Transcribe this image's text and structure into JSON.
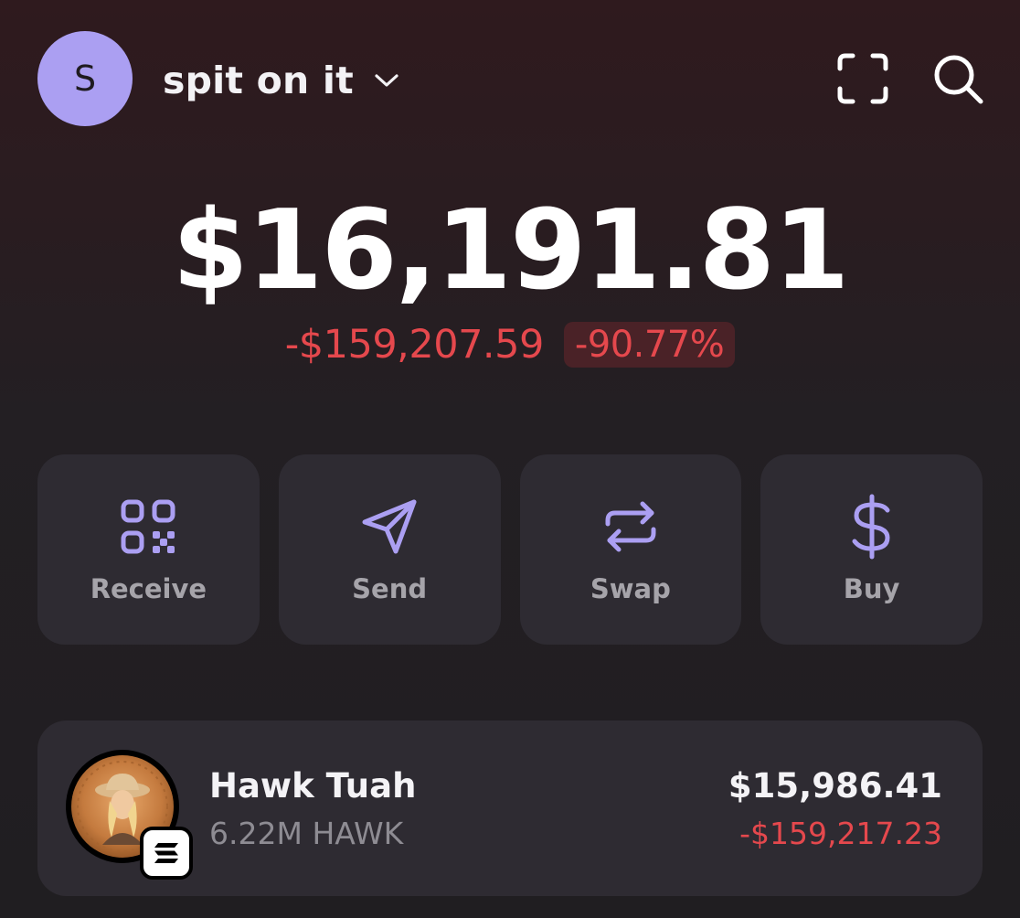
{
  "header": {
    "avatar_initial": "S",
    "account_name": "spit on it",
    "icons": [
      "chevron-down-icon",
      "scan-icon",
      "search-icon"
    ]
  },
  "portfolio": {
    "balance": "$16,191.81",
    "change_amount": "-$159,207.59",
    "change_percent": "-90.77%"
  },
  "actions": [
    {
      "label": "Receive",
      "icon": "qr-code-icon"
    },
    {
      "label": "Send",
      "icon": "send-icon"
    },
    {
      "label": "Swap",
      "icon": "swap-icon"
    },
    {
      "label": "Buy",
      "icon": "dollar-icon"
    }
  ],
  "tokens": [
    {
      "name": "Hawk Tuah",
      "amount": "6.22M HAWK",
      "value": "$15,986.41",
      "change": "-$159,217.23",
      "chain_icon": "solana-icon"
    }
  ],
  "colors": {
    "accent": "#ab9ff2",
    "negative": "#e5484d",
    "negative_bg": "#4a2227",
    "card": "#2e2b32",
    "label": "#a6a4aa"
  }
}
